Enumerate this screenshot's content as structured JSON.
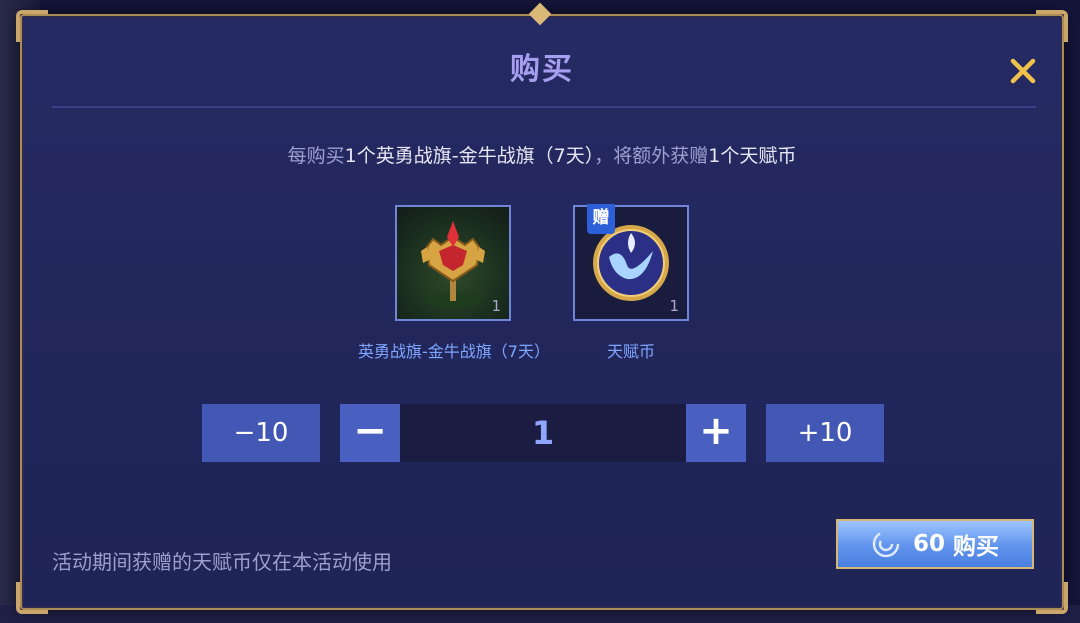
{
  "dialog": {
    "title": "购买",
    "close_icon": "close-x-icon"
  },
  "info": {
    "prefix": "每购买",
    "item_part": "1个英勇战旗-金牛战旗（7天）",
    "middle": "，将额外获赠",
    "bonus_part": "1个天赋币"
  },
  "items": [
    {
      "name": "英勇战旗-金牛战旗（7天）",
      "count": "1",
      "icon": "banner-trophy-icon"
    },
    {
      "name": "天赋币",
      "count": "1",
      "badge": "赠",
      "icon": "talent-coin-icon"
    }
  ],
  "quantity": {
    "minus10_label": "−10",
    "minus_label": "−",
    "value": "1",
    "plus_label": "+",
    "plus10_label": "+10"
  },
  "notice": "活动期间获赠的天赋币仅在本活动使用",
  "buy_button": {
    "price": "60",
    "label": "购买",
    "currency_icon": "swirl-currency-icon"
  },
  "colors": {
    "panel": "#23285d",
    "accent": "#4a60c0",
    "gold": "#caa66a",
    "title": "#a69ff0"
  }
}
